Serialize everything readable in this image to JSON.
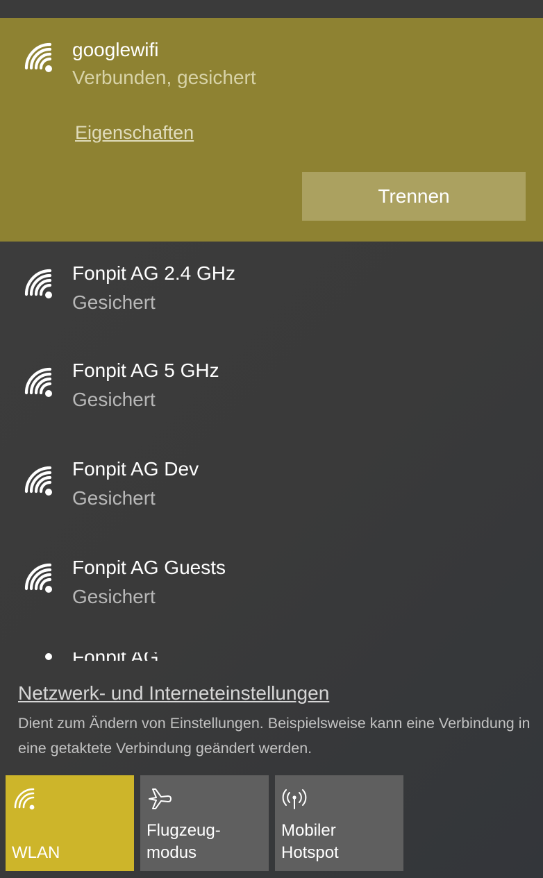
{
  "connected_network": {
    "name": "googlewifi",
    "status": "Verbunden, gesichert",
    "properties_link": "Eigenschaften",
    "disconnect_label": "Trennen",
    "icon": "wifi-signal-icon"
  },
  "networks": [
    {
      "name": "Fonpit AG 2.4 GHz",
      "status": "Gesichert"
    },
    {
      "name": "Fonpit AG 5 GHz",
      "status": "Gesichert"
    },
    {
      "name": "Fonpit AG Dev",
      "status": "Gesichert"
    },
    {
      "name": "Fonpit AG Guests",
      "status": "Gesichert"
    },
    {
      "name": "Fonpit AG",
      "status": ""
    }
  ],
  "settings": {
    "link": "Netzwerk- und Interneteinstellungen",
    "description": "Dient zum Ändern von Einstellungen. Beispielsweise kann eine Verbindung in eine getaktete Verbindung geändert werden."
  },
  "quick_actions": [
    {
      "label": "WLAN",
      "icon": "wifi-icon",
      "active": true
    },
    {
      "label": "Flugzeug-\nmodus",
      "icon": "airplane-icon",
      "active": false
    },
    {
      "label": "Mobiler\nHotspot",
      "icon": "hotspot-icon",
      "active": false
    }
  ],
  "colors": {
    "connected_bg": "#8e8232",
    "disconnect_button": "#aba160",
    "accent_tile": "#cdb52a",
    "tile_bg": "#5f5f5f",
    "panel_bg": "#3d3d3d"
  }
}
